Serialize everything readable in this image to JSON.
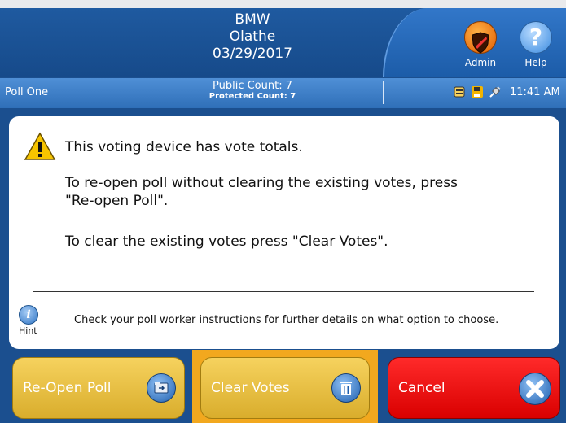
{
  "header": {
    "org": "BMW",
    "location": "Olathe",
    "date": "03/29/2017",
    "admin_label": "Admin",
    "help_label": "Help",
    "help_glyph": "?"
  },
  "status_bar": {
    "poll_name": "Poll One",
    "public_count": "Public Count: 7",
    "protected_count": "Protected Count: 7",
    "time": "11:41 AM"
  },
  "message": {
    "warning": "This voting device has vote totals.",
    "line1a": "To re-open poll without clearing the existing votes, press",
    "line1b": "\"Re-open Poll\".",
    "line2": "To clear the existing votes press \"Clear Votes\".",
    "hint_glyph": "i",
    "hint_label": "Hint",
    "hint_text": "Check your poll worker instructions for further details on what option to choose."
  },
  "buttons": {
    "reopen": "Re-Open Poll",
    "clear": "Clear Votes",
    "cancel": "Cancel"
  },
  "colors": {
    "header_blue": "#1b4f8f",
    "button_yellow": "#e8c040",
    "button_red": "#ee0000",
    "focus_orange": "#f2a81e"
  }
}
